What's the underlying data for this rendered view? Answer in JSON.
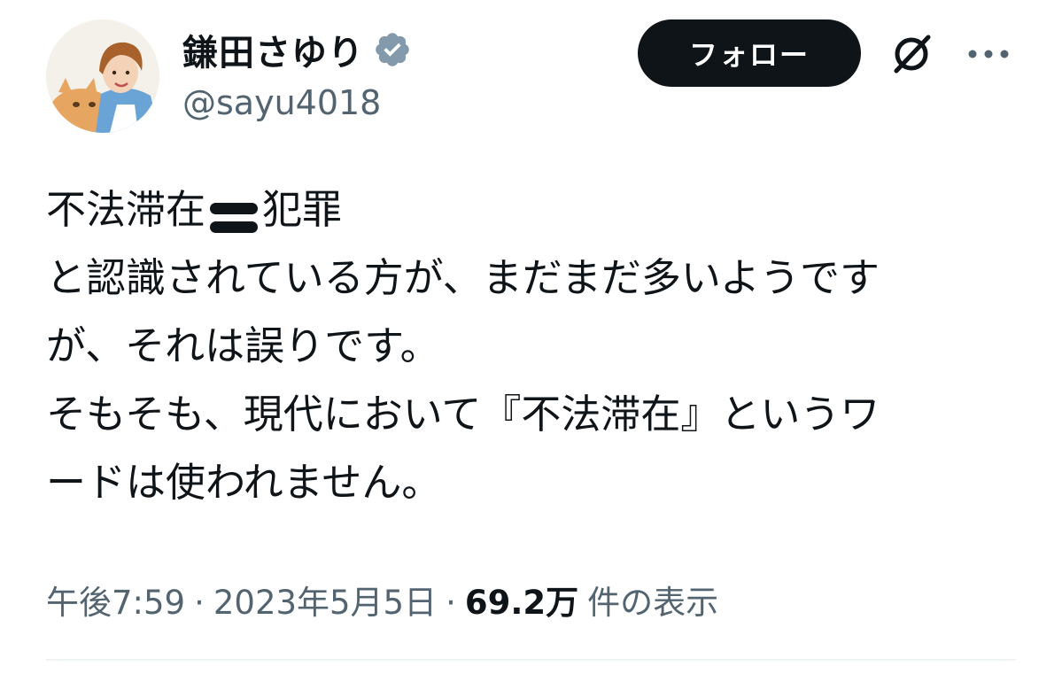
{
  "author": {
    "display_name": "鎌田さゆり",
    "handle": "@sayu4018",
    "verified": true,
    "verified_badge_color": "#829aab"
  },
  "actions": {
    "follow_label": "フォロー",
    "grok_icon": "grok-icon",
    "more_icon": "more-icon",
    "follow_bg": "#0f1419"
  },
  "tweet": {
    "line1_before": "不法滞在",
    "line1_emoji": "heavy-equals-sign-emoji",
    "line1_after": "犯罪",
    "line2": "と認識されている方が、まだまだ多いようです",
    "line3": "が、それは誤りです。",
    "line4": "そもそも、現代において『不法滞在』というワ",
    "line5": "ードは使われません。"
  },
  "meta": {
    "time": "午後7:59",
    "separator": "·",
    "date": "2023年5月5日",
    "views_count": "69.2万",
    "views_label": "件の表示"
  }
}
